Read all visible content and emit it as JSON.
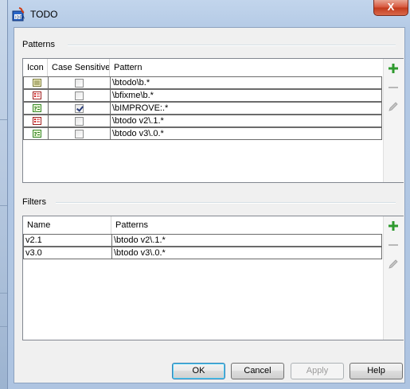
{
  "window": {
    "title": "TODO",
    "close_label": "X"
  },
  "patterns": {
    "label": "Patterns",
    "columns": [
      "Icon",
      "Case Sensitive",
      "Pattern"
    ],
    "rows": [
      {
        "icon": "todo-note-icon",
        "case_sensitive": false,
        "pattern": "\\btodo\\b.*"
      },
      {
        "icon": "fixme-red-icon",
        "case_sensitive": false,
        "pattern": "\\bfixme\\b.*"
      },
      {
        "icon": "improve-question-icon",
        "case_sensitive": true,
        "pattern": "\\bIMPROVE:.*"
      },
      {
        "icon": "fixme-red-icon",
        "case_sensitive": false,
        "pattern": "\\btodo v2\\.1.*"
      },
      {
        "icon": "improve-question-icon",
        "case_sensitive": false,
        "pattern": "\\btodo v3\\.0.*"
      }
    ]
  },
  "filters": {
    "label": "Filters",
    "columns": [
      "Name",
      "Patterns"
    ],
    "rows": [
      {
        "name": "v2.1",
        "patterns": "\\btodo v2\\.1.*"
      },
      {
        "name": "v3.0",
        "patterns": "\\btodo v3\\.0.*"
      }
    ]
  },
  "side_buttons": {
    "add": "add-icon",
    "remove": "remove-icon",
    "edit": "edit-icon"
  },
  "buttons": {
    "ok": "OK",
    "cancel": "Cancel",
    "apply": "Apply",
    "help": "Help"
  },
  "colors": {
    "add_green": "#2e9a2e",
    "disabled_gray": "#b8b8b8"
  }
}
